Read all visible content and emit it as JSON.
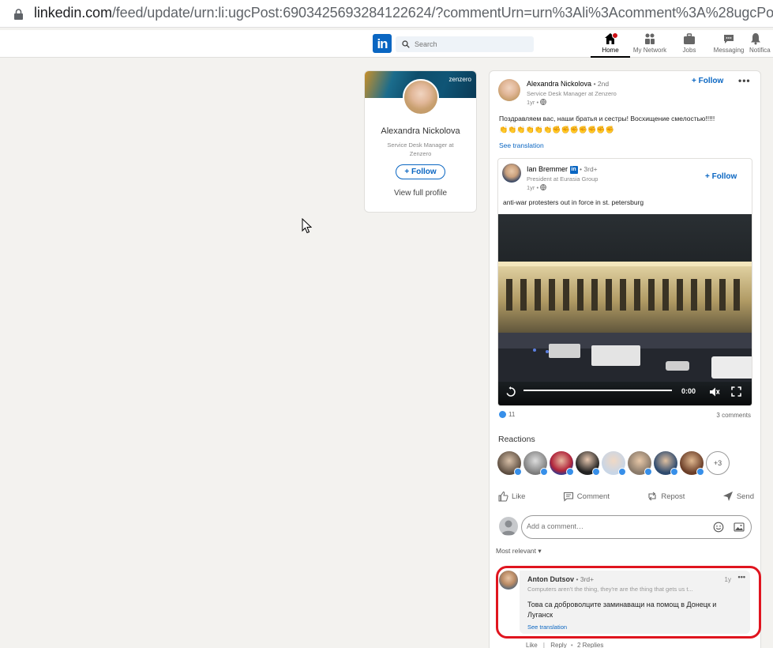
{
  "browser": {
    "url_host": "linkedin.com",
    "url_path": "/feed/update/urn:li:ugcPost:6903425693284122624/?commentUrn=urn%3Ali%3Acomment%3A%28ugcPost%"
  },
  "nav": {
    "logo": "in",
    "search_placeholder": "Search",
    "items": [
      {
        "label": "Home",
        "icon": "home-icon"
      },
      {
        "label": "My Network",
        "icon": "network-icon"
      },
      {
        "label": "Jobs",
        "icon": "jobs-icon"
      },
      {
        "label": "Messaging",
        "icon": "messaging-icon"
      },
      {
        "label": "Notifica",
        "icon": "bell-icon"
      }
    ]
  },
  "profile_card": {
    "banner_tag": "zenzero",
    "name": "Alexandra Nickolova",
    "headline": "Service Desk Manager at Zenzero",
    "follow_label": "+ Follow",
    "view_profile_label": "View full profile"
  },
  "post": {
    "author": "Alexandra Nickolova",
    "degree": "• 2nd",
    "headline": "Service Desk Manager at Zenzero",
    "time": "1yr •",
    "follow_label": "+ Follow",
    "more": "•••",
    "text": "Поздравляем вас, наши братья и сестры! Восхищение смелостью!!!!!",
    "emoji_line": "👏👏👏👏👏👏✊✊✊✊✊✊✊",
    "see_translation": "See translation",
    "shared": {
      "author": "Ian Bremmer",
      "li_badge": "in",
      "degree": "• 3rd+",
      "headline": "President at Eurasia Group",
      "time": "1yr •",
      "follow_label": "+ Follow",
      "text": "anti-war protesters out in force in st. petersburg",
      "video_time": "0:00"
    },
    "reactions_count": "11",
    "comments_count": "3 comments",
    "reactions_title": "Reactions",
    "more_reactors": "+3",
    "actions": [
      {
        "label": "Like",
        "icon": "like-icon"
      },
      {
        "label": "Comment",
        "icon": "comment-icon"
      },
      {
        "label": "Repost",
        "icon": "repost-icon"
      },
      {
        "label": "Send",
        "icon": "send-icon"
      }
    ],
    "comment_placeholder": "Add a comment…",
    "sort_label": "Most relevant ▾",
    "comment": {
      "author": "Anton Dutsov",
      "degree": "• 3rd+",
      "headline": "Computers aren't the thing, they're are the thing that gets us t...",
      "time": "1y",
      "more": "•••",
      "text": "Това са доброволците заминаващи на помощ в Донецк и Луганск",
      "see_translation": "See translation",
      "footer_like": "Like",
      "footer_reply": "Reply",
      "footer_replies": "2 Replies"
    }
  },
  "colors": {
    "linkedin_blue": "#0a66c2",
    "highlight_red": "#e0151f",
    "page_bg": "#f3f2ef"
  }
}
